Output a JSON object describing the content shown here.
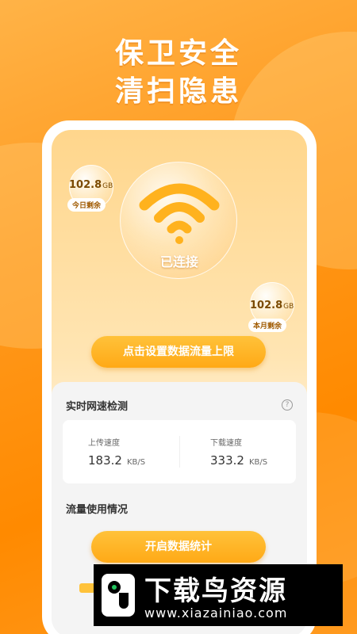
{
  "headline": {
    "line1": "保卫安全",
    "line2": "清扫隐患"
  },
  "today": {
    "value": "102.8",
    "unit": "GB",
    "label": "今日剩余"
  },
  "month": {
    "value": "102.8",
    "unit": "GB",
    "label": "本月剩余"
  },
  "wifi": {
    "status": "已连接",
    "icon": "wifi-icon"
  },
  "limit_button": {
    "label": "点击设置数据流量上限"
  },
  "speed": {
    "title": "实时网速检测",
    "help_icon": "question-circle-icon",
    "upload": {
      "label": "上传速度",
      "value": "183.2",
      "unit": "KB/S"
    },
    "download": {
      "label": "下载速度",
      "value": "333.2",
      "unit": "KB/S"
    }
  },
  "usage": {
    "title": "流量使用情况",
    "button_label": "开启数据统计"
  },
  "watermark": {
    "title": "下载鸟资源",
    "url": "www.xiazainiao.com"
  },
  "colors": {
    "accent": "#ffa916",
    "background": "#ff9a1f"
  }
}
